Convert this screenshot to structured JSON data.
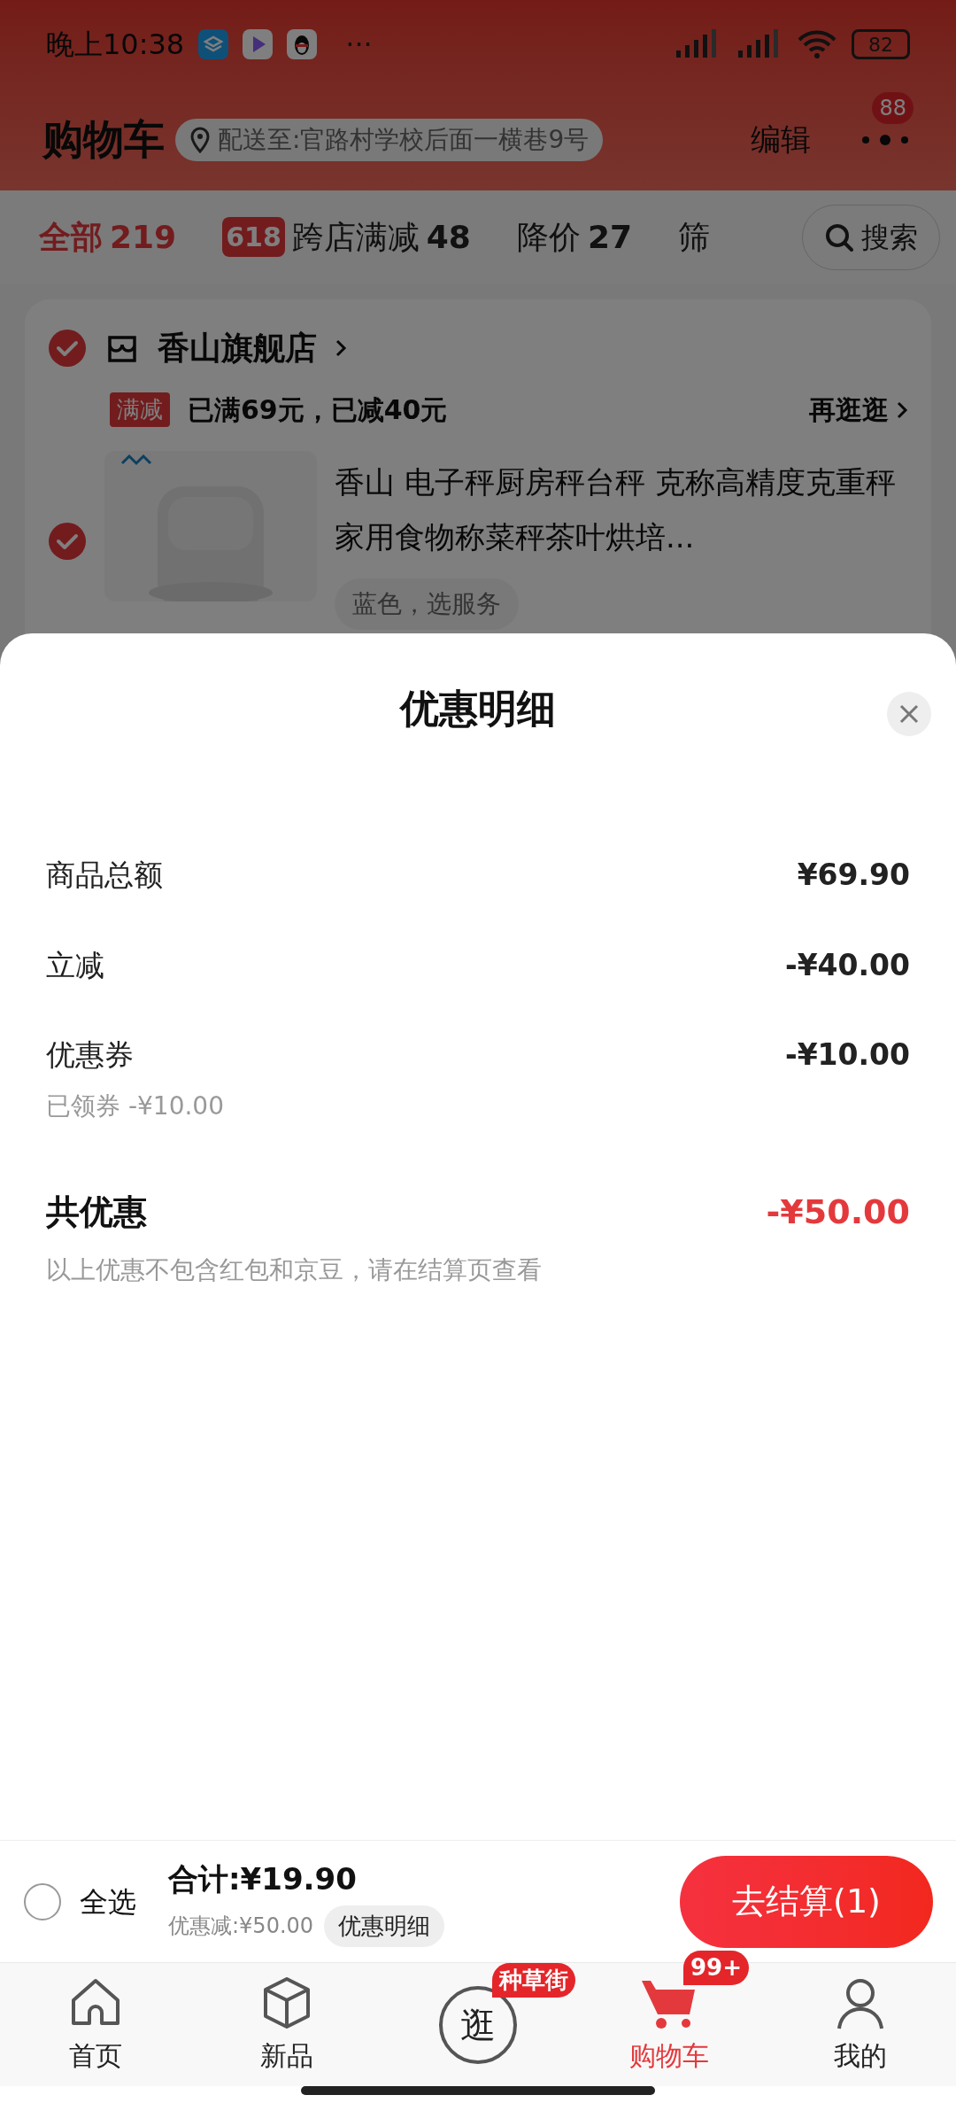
{
  "status_bar": {
    "time": "晚上10:38",
    "dots": "···",
    "battery": "82"
  },
  "header": {
    "title": "购物车",
    "address": "配送至:官路村学校后面一横巷9号",
    "edit": "编辑",
    "message_badge": "88"
  },
  "tabs": [
    {
      "label": "全部",
      "count": "219",
      "selected": true
    },
    {
      "label": "跨店满减",
      "count": "48",
      "badge": "618",
      "selected": false
    },
    {
      "label": "降价",
      "count": "27",
      "selected": false
    },
    {
      "label": "筛",
      "selected": false
    }
  ],
  "search": {
    "label": "搜索"
  },
  "store": {
    "name": "香山旗舰店",
    "checked": true,
    "promo_tag": "满减",
    "promo_text": "已满69元，已减40元",
    "promo_link": "再逛逛",
    "product": {
      "checked": true,
      "title": "香山 电子秤厨房秤台秤 克称高精度克重秤家用食物称菜秤茶叶烘培...",
      "spec": "蓝色，选服务"
    }
  },
  "sheet": {
    "title": "优惠明细",
    "rows": [
      {
        "label": "商品总额",
        "value": "¥69.90"
      },
      {
        "label": "立减",
        "value": "-¥40.00"
      },
      {
        "label": "优惠券",
        "value": "-¥10.00",
        "note": "已领券 -¥10.00"
      }
    ],
    "total": {
      "label": "共优惠",
      "value": "-¥50.00"
    },
    "note": "以上优惠不包含红包和京豆，请在结算页查看"
  },
  "bottom_bar": {
    "select_all": {
      "label": "全选",
      "checked": false
    },
    "total": "合计:¥19.90",
    "discount": "优惠减:¥50.00",
    "detail_button": "优惠明细",
    "checkout": "去结算(1)"
  },
  "nav": [
    {
      "kind": "home",
      "label": "首页",
      "selected": false
    },
    {
      "kind": "new",
      "label": "新品",
      "selected": false
    },
    {
      "kind": "stroll",
      "glyph": "逛",
      "badge": "种草街",
      "selected": false
    },
    {
      "kind": "cart",
      "label": "购物车",
      "badge": "99+",
      "selected": true
    },
    {
      "kind": "me",
      "label": "我的",
      "selected": false
    }
  ]
}
